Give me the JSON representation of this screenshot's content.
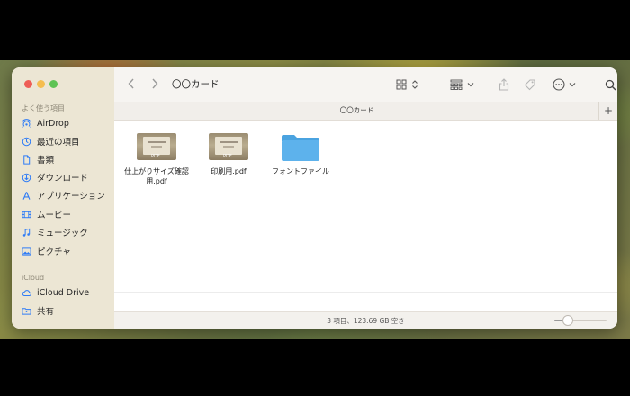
{
  "window": {
    "title": "〇〇カード",
    "tab_title": "〇〇カード"
  },
  "sidebar": {
    "favorites_header": "よく使う項目",
    "favorites": [
      {
        "label": "AirDrop",
        "icon": "airdrop-icon"
      },
      {
        "label": "最近の項目",
        "icon": "clock-icon"
      },
      {
        "label": "書類",
        "icon": "document-icon"
      },
      {
        "label": "ダウンロード",
        "icon": "download-icon"
      },
      {
        "label": "アプリケーション",
        "icon": "applications-icon"
      },
      {
        "label": "ムービー",
        "icon": "film-icon"
      },
      {
        "label": "ミュージック",
        "icon": "music-icon"
      },
      {
        "label": "ピクチャ",
        "icon": "photo-icon"
      }
    ],
    "icloud_header": "iCloud",
    "icloud": [
      {
        "label": "iCloud Drive",
        "icon": "cloud-icon"
      },
      {
        "label": "共有",
        "icon": "shared-folder-icon"
      }
    ]
  },
  "files": [
    {
      "name": "仕上がりサイズ確認用.pdf",
      "kind": "pdf"
    },
    {
      "name": "印刷用.pdf",
      "kind": "pdf"
    },
    {
      "name": "フォントファイル",
      "kind": "folder"
    }
  ],
  "status": {
    "text": "3 項目、123.69 GB 空き",
    "icon_size_level": 0.25
  },
  "colors": {
    "accent": "#2f7cf6",
    "folder": "#5db2ec",
    "sidebar_bg": "#ece6d4"
  }
}
